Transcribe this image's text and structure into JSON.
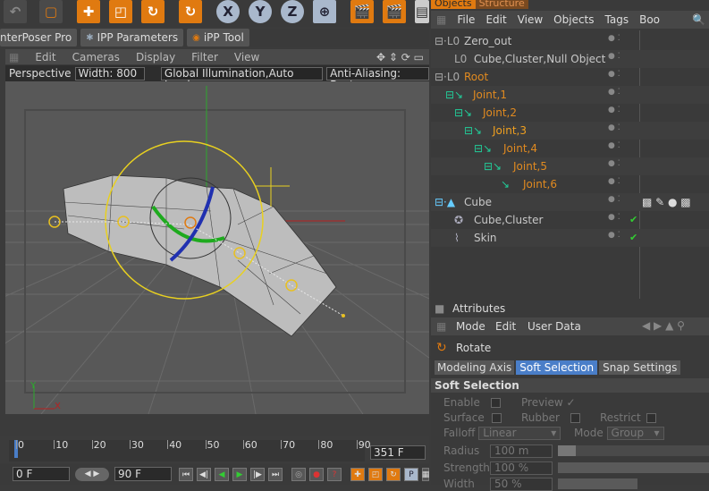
{
  "top_toolbar": {
    "buttons": [
      "undo-icon",
      "select-icon",
      "move-icon",
      "scale-icon",
      "rotate-icon",
      "rotate-icon",
      "x-axis",
      "y-axis",
      "z-axis",
      "world-coords",
      "render-view",
      "render-picture",
      "render-settings"
    ],
    "axis_x": "X",
    "axis_y": "Y",
    "axis_z": "Z"
  },
  "plugin_tabs": [
    "nterPoser Pro",
    "IPP Parameters",
    "iPP Tool"
  ],
  "viewport": {
    "menu": [
      "Edit",
      "Cameras",
      "Display",
      "Filter",
      "View"
    ],
    "camera": "Perspective",
    "width_label": "Width:",
    "width_value": "800",
    "render_mode": "Global Illumination,Auto Load",
    "anti_aliasing": "Anti-Aliasing: Best",
    "axis_y": "Y",
    "axis_x": "X"
  },
  "timeline": {
    "ticks": [
      "0",
      "10",
      "20",
      "30",
      "40",
      "50",
      "60",
      "70",
      "80",
      "90"
    ],
    "end_frame": "351 F",
    "current_frame": "0 F",
    "max_frame": "90 F"
  },
  "object_manager": {
    "tabs": [
      "Objects",
      "Structure"
    ],
    "menu": [
      "File",
      "Edit",
      "View",
      "Objects",
      "Tags",
      "Boo"
    ],
    "items": [
      {
        "name": "Zero_out",
        "color": "#d0d0d0"
      },
      {
        "name": "Cube,Cluster,Null Object",
        "color": "#d0d0d0"
      },
      {
        "name": "Root",
        "color": "#e08a20"
      },
      {
        "name": "Joint,1",
        "color": "#e08a20"
      },
      {
        "name": "Joint,2",
        "color": "#e08a20"
      },
      {
        "name": "Joint,3",
        "color": "#f0a020"
      },
      {
        "name": "Joint,4",
        "color": "#e08a20"
      },
      {
        "name": "Joint,5",
        "color": "#e08a20"
      },
      {
        "name": "Joint,6",
        "color": "#e08a20"
      },
      {
        "name": "Cube",
        "color": "#d0d0d0"
      },
      {
        "name": "Cube,Cluster",
        "color": "#d0d0d0"
      },
      {
        "name": "Skin",
        "color": "#d0d0d0"
      }
    ]
  },
  "attributes": {
    "title": "Attributes",
    "menu": [
      "Mode",
      "Edit",
      "User Data"
    ],
    "object": "Rotate",
    "tabs": [
      "Modeling Axis",
      "Soft Selection",
      "Snap Settings"
    ],
    "section": "Soft Selection",
    "enable": "Enable",
    "preview": "Preview",
    "surface": "Surface",
    "rubber": "Rubber",
    "restrict": "Restrict",
    "falloff_label": "Falloff",
    "falloff_value": "Linear",
    "mode_label": "Mode",
    "mode_value": "Group",
    "radius_label": "Radius",
    "radius_value": "100 m",
    "strength_label": "Strength",
    "strength_value": "100 %",
    "width_label": "Width",
    "width_value": "50 %"
  },
  "colors": {
    "accent_orange": "#e07a10",
    "selection_blue": "#4a7ec8",
    "joint_orange": "#e08a20"
  }
}
